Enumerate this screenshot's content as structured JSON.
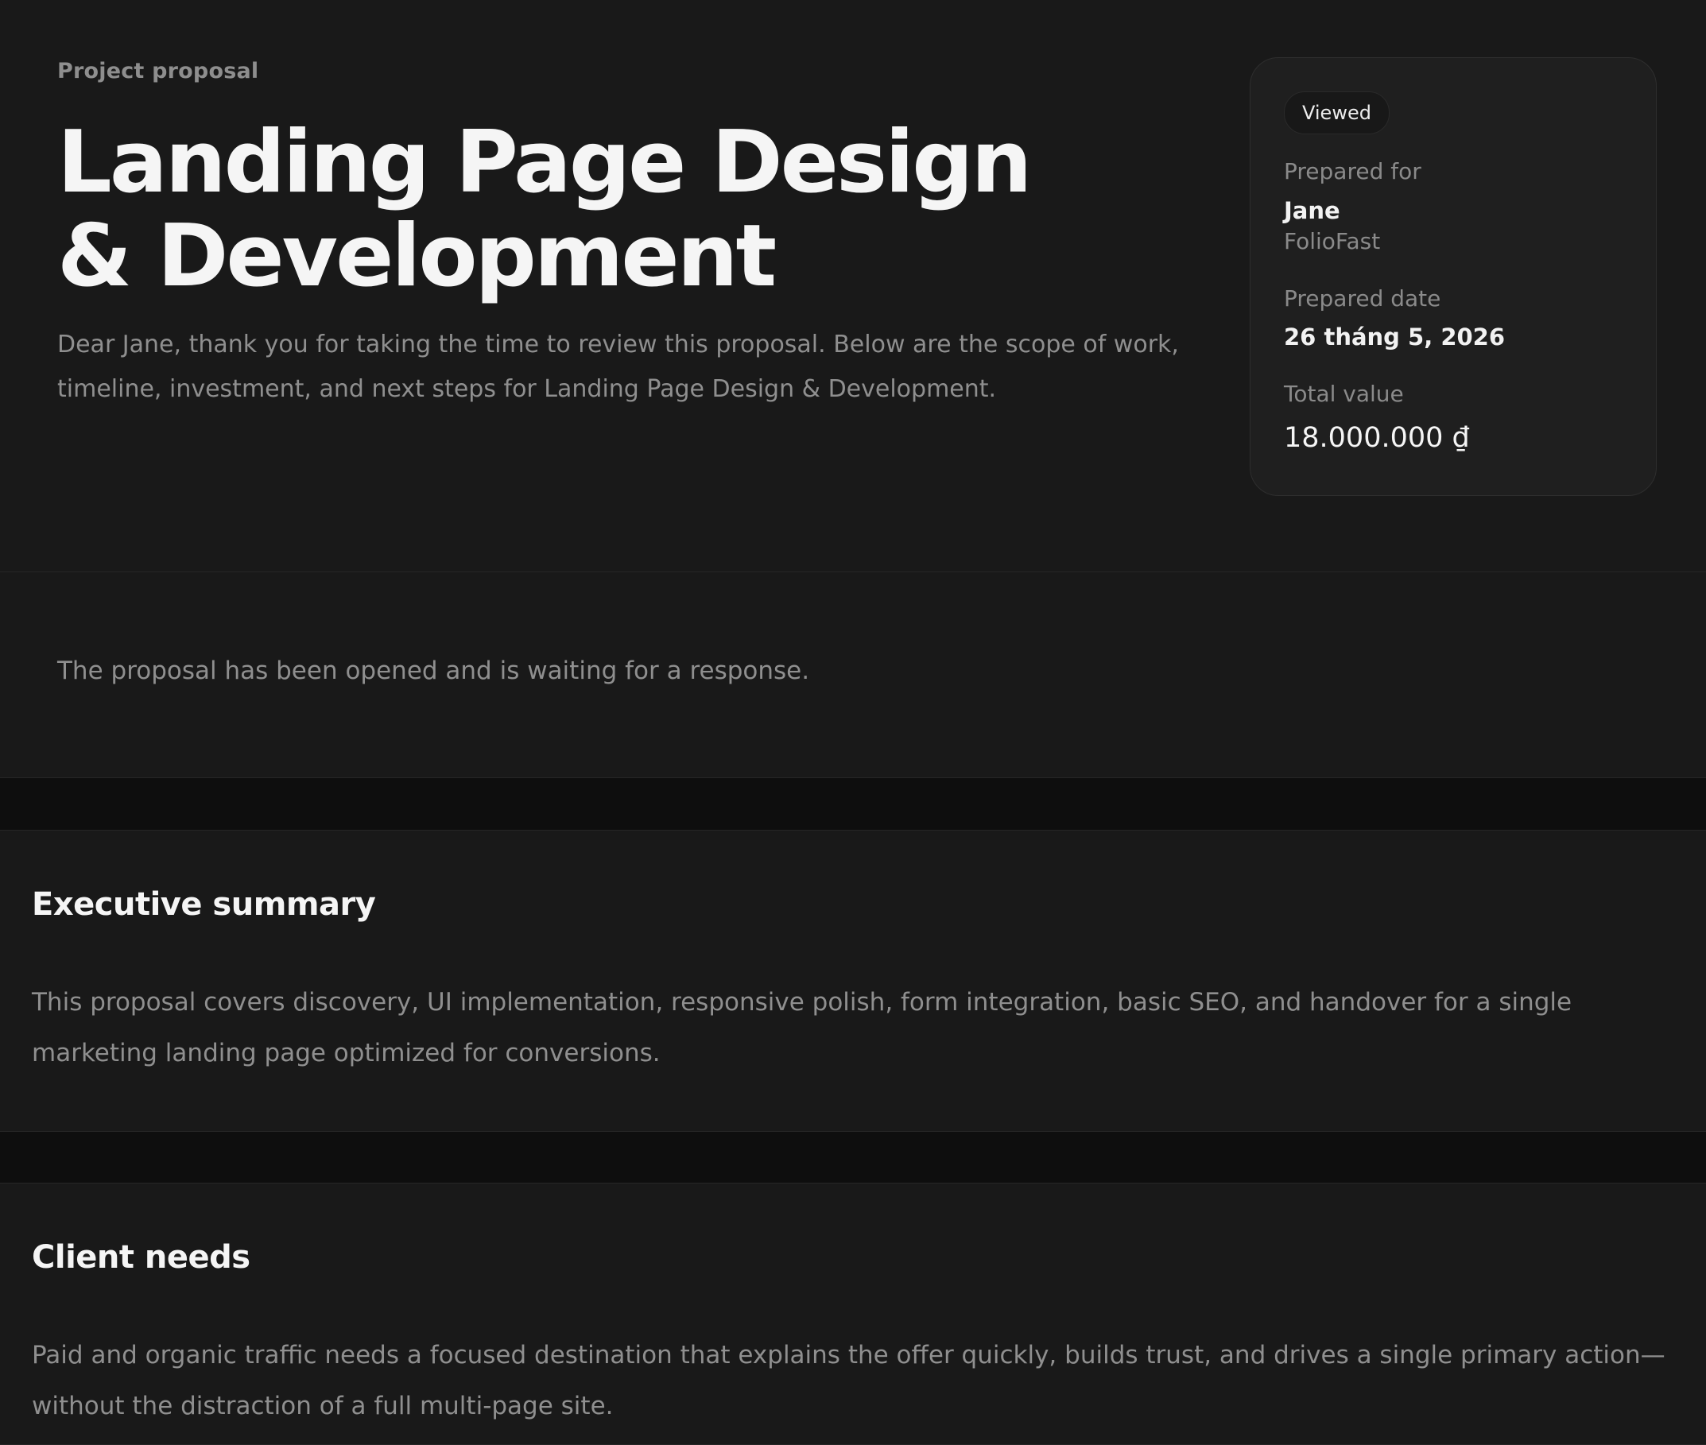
{
  "hero": {
    "eyebrow": "Project proposal",
    "title_line1": "Landing Page Design",
    "title_line2": "& Development",
    "intro": "Dear Jane, thank you for taking the time to review this proposal. Below are the scope of work, timeline, investment, and next steps for Landing Page Design & Development."
  },
  "meta": {
    "status_badge": "Viewed",
    "prepared_for_label": "Prepared for",
    "client_name": "Jane",
    "client_company": "FolioFast",
    "prepared_date_label": "Prepared date",
    "prepared_date": "26 tháng 5, 2026",
    "total_value_label": "Total value",
    "total_value": "18.000.000 ₫"
  },
  "status": {
    "message": "The proposal has been opened and is waiting for a response."
  },
  "sections": {
    "executive_summary": {
      "title": "Executive summary",
      "body": "This proposal covers discovery, UI implementation, responsive polish, form integration, basic SEO, and handover for a single marketing landing page optimized for conversions."
    },
    "client_needs": {
      "title": "Client needs",
      "body": "Paid and organic traffic needs a focused destination that explains the offer quickly, builds trust, and drives a single primary action—without the distraction of a full multi-page site."
    }
  },
  "colors": {
    "page_background": "#0e0e0e",
    "panel_background": "#191919",
    "card_background": "#1f1f1f",
    "muted_text": "#8f8f8f",
    "primary_text": "#f5f5f5"
  }
}
